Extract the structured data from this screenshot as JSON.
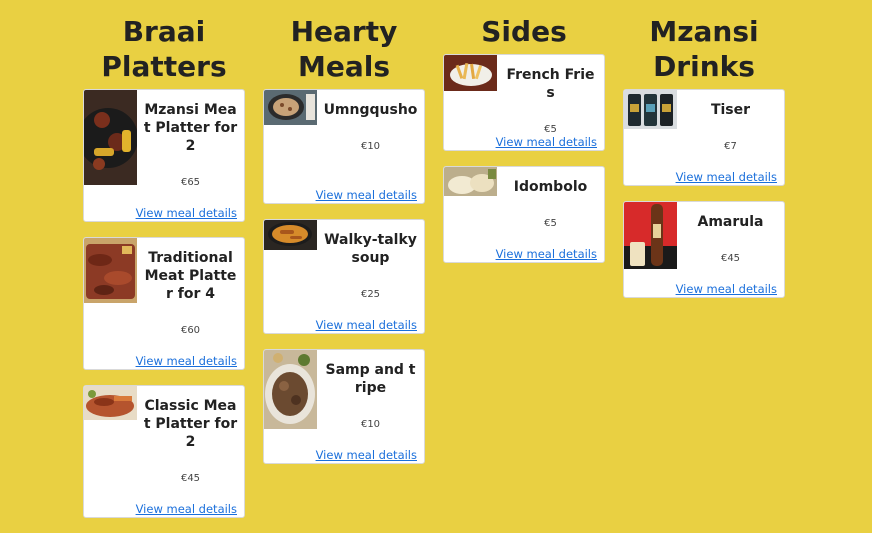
{
  "link_label": "View meal details",
  "columns": [
    {
      "heading": "Braai Platters",
      "items": [
        {
          "title": "Mzansi Meat Platter for 2",
          "price": "€65"
        },
        {
          "title": "Traditional Meat Platter for 4",
          "price": "€60"
        },
        {
          "title": "Classic Meat Platter for 2",
          "price": "€45"
        }
      ]
    },
    {
      "heading": "Hearty Meals",
      "items": [
        {
          "title": "Umngqusho",
          "price": "€10"
        },
        {
          "title": "Walky-talky soup",
          "price": "€25"
        },
        {
          "title": "Samp and tripe",
          "price": "€10"
        }
      ]
    },
    {
      "heading": "Sides",
      "items": [
        {
          "title": "French Fries",
          "price": "€5"
        },
        {
          "title": "Idombolo",
          "price": "€5"
        }
      ]
    },
    {
      "heading": "Mzansi Drinks",
      "items": [
        {
          "title": "Tiser",
          "price": "€7"
        },
        {
          "title": "Amarula",
          "price": "€45"
        }
      ]
    }
  ],
  "colors": {
    "background": "#e9d042",
    "card": "#ffffff",
    "link": "#1a6fdb"
  }
}
